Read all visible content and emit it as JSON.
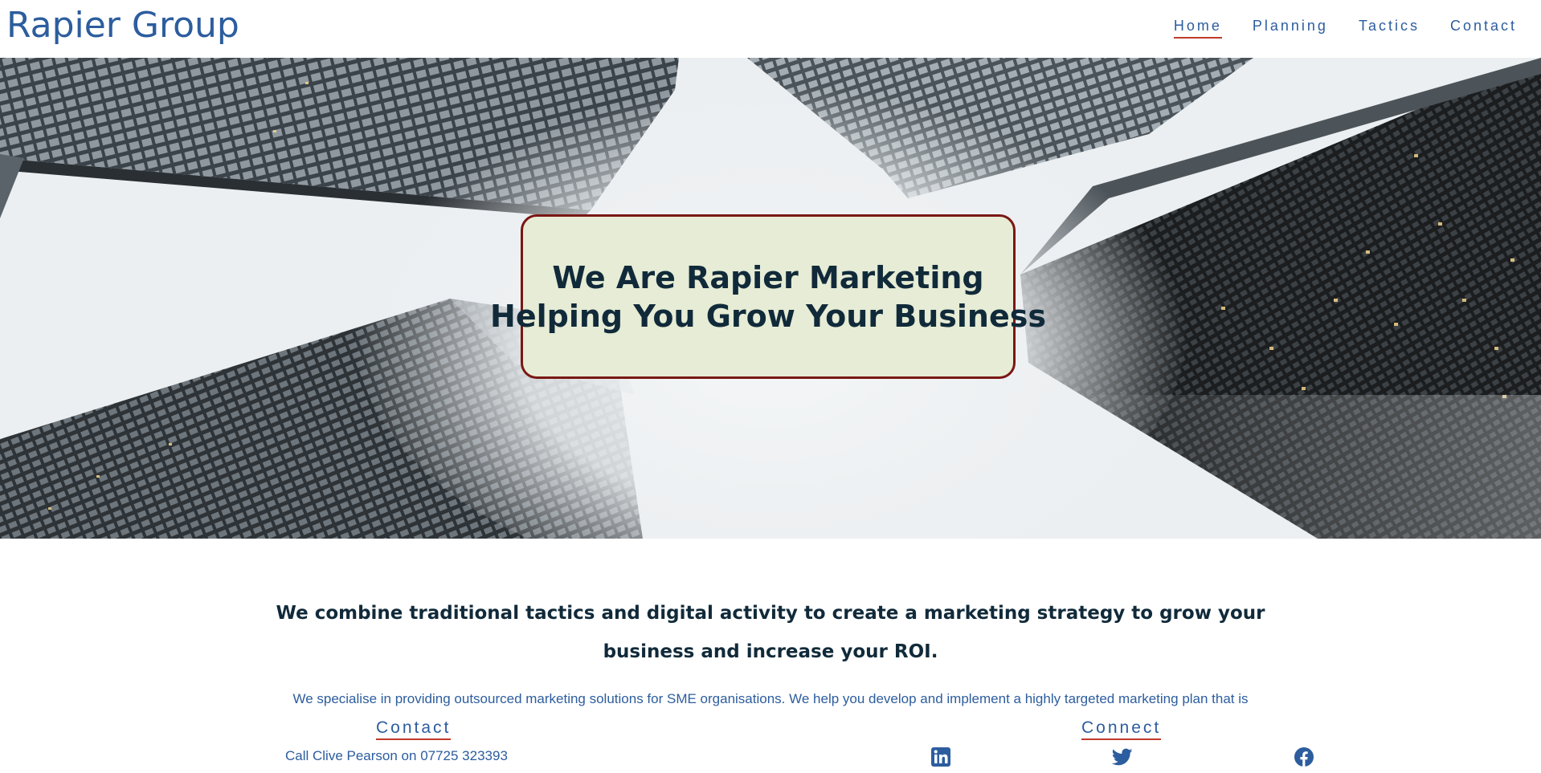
{
  "header": {
    "brand": "Rapier Group",
    "nav": [
      {
        "label": "Home",
        "active": true
      },
      {
        "label": "Planning",
        "active": false
      },
      {
        "label": "Tactics",
        "active": false
      },
      {
        "label": "Contact",
        "active": false
      }
    ]
  },
  "hero": {
    "line1": "We Are Rapier Marketing",
    "line2": "Helping You Grow Your Business"
  },
  "intro": {
    "lead": "We combine traditional tactics and digital activity to create a marketing strategy to grow your business and increase your ROI.",
    "body": "We specialise in providing outsourced marketing solutions for SME organisations. We help you develop and implement a highly targeted marketing plan that is"
  },
  "footer": {
    "contact_title": "Contact",
    "contact_text": "Call Clive Pearson on 07725 323393",
    "connect_title": "Connect",
    "social": [
      "linkedin-icon",
      "twitter-icon",
      "facebook-icon"
    ]
  },
  "colors": {
    "brand_blue": "#2c5d9e",
    "accent_red": "#c0392b",
    "card_border": "#7a1714",
    "card_bg": "#e6ecd5",
    "heading_dark": "#112a3a"
  }
}
